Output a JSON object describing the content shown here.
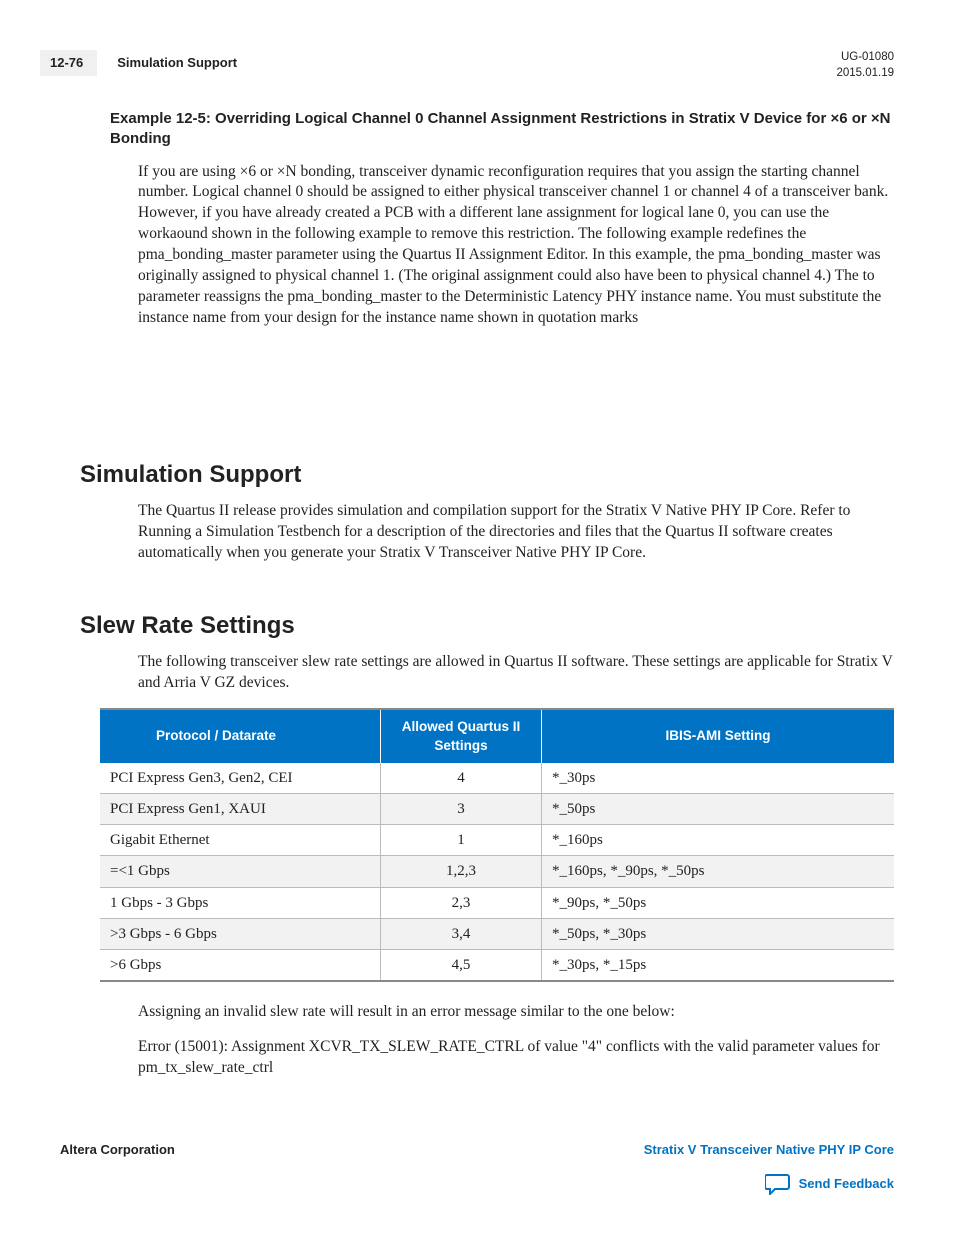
{
  "header": {
    "page_number": "12-76",
    "section_title": "Simulation Support",
    "doc_id": "UG-01080",
    "doc_date": "2015.01.19"
  },
  "example": {
    "title": "Example 12-5: Overriding Logical Channel 0 Channel Assignment Restrictions in Stratix V Device for ×6 or ×N Bonding",
    "body": "If you are using ×6 or ×N bonding, transceiver dynamic reconfiguration requires that you assign the starting channel number. Logical channel 0 should be assigned to either physical transceiver channel 1 or channel 4 of a transceiver bank. However, if you have already created a PCB with a different lane assignment for logical lane 0, you can use the workaound shown in the following example to remove this restriction. The following example redefines the pma_bonding_master parameter using the Quartus II Assignment Editor. In this example, the pma_bonding_master was originally assigned to physical channel 1. (The original assignment could also have been to physical channel 4.) The to parameter reassigns the pma_bonding_master to the Deterministic Latency PHY instance name. You must substitute the instance name from your design for the instance name shown in quotation marks"
  },
  "sections": {
    "sim": {
      "heading": "Simulation Support",
      "body": "The Quartus II release provides simulation and compilation support for the Stratix V Native PHY IP Core. Refer to Running a Simulation Testbench for a description of the directories and files that the Quartus II software creates automatically when you generate your Stratix V Transceiver Native PHY IP Core."
    },
    "slew": {
      "heading": "Slew Rate Settings",
      "intro": "The following transceiver slew rate settings are allowed in Quartus II software. These settings are applicable for Stratix V and Arria V GZ devices.",
      "table": {
        "headers": [
          "Protocol / Datarate",
          "Allowed Quartus II Settings",
          "IBIS-AMI Setting"
        ],
        "rows": [
          [
            "PCI Express Gen3, Gen2, CEI",
            "4",
            "*_30ps"
          ],
          [
            "PCI Express Gen1, XAUI",
            "3",
            "*_50ps"
          ],
          [
            "Gigabit Ethernet",
            "1",
            "*_160ps"
          ],
          [
            "=<1 Gbps",
            "1,2,3",
            "*_160ps, *_90ps, *_50ps"
          ],
          [
            "1 Gbps - 3 Gbps",
            "2,3",
            "*_90ps, *_50ps"
          ],
          [
            ">3 Gbps - 6 Gbps",
            "3,4",
            "*_50ps, *_30ps"
          ],
          [
            ">6 Gbps",
            "4,5",
            "*_30ps, *_15ps"
          ]
        ]
      },
      "after1": "Assigning an invalid slew rate will result in an error message similar to the one below:",
      "after2": "Error (15001): Assignment XCVR_TX_SLEW_RATE_CTRL of value \"4\" conflicts with the valid parameter values for pm_tx_slew_rate_ctrl"
    }
  },
  "footer": {
    "left": "Altera Corporation",
    "right": "Stratix V Transceiver Native PHY IP Core",
    "feedback": "Send Feedback"
  }
}
